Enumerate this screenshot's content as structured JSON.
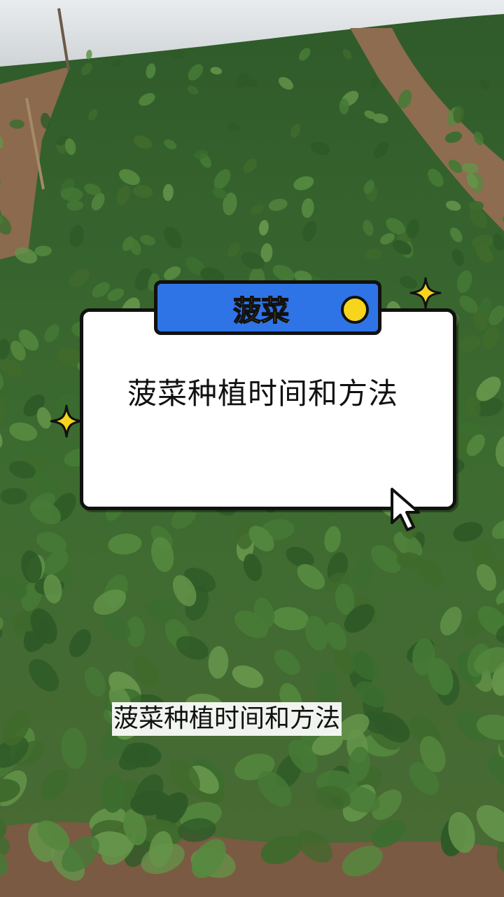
{
  "tag": {
    "label": "菠菜"
  },
  "card": {
    "title": "菠菜种植时间和方法"
  },
  "caption": {
    "text": "菠菜种植时间和方法"
  },
  "colors": {
    "tag_bg": "#2f74e6",
    "tag_text": "#f7d51d",
    "sparkle": "#f7d51d",
    "outline": "#111111",
    "card_bg": "#ffffff"
  },
  "icons": [
    "sparkle-icon",
    "yellow-dot-icon",
    "cursor-arrow-icon"
  ]
}
